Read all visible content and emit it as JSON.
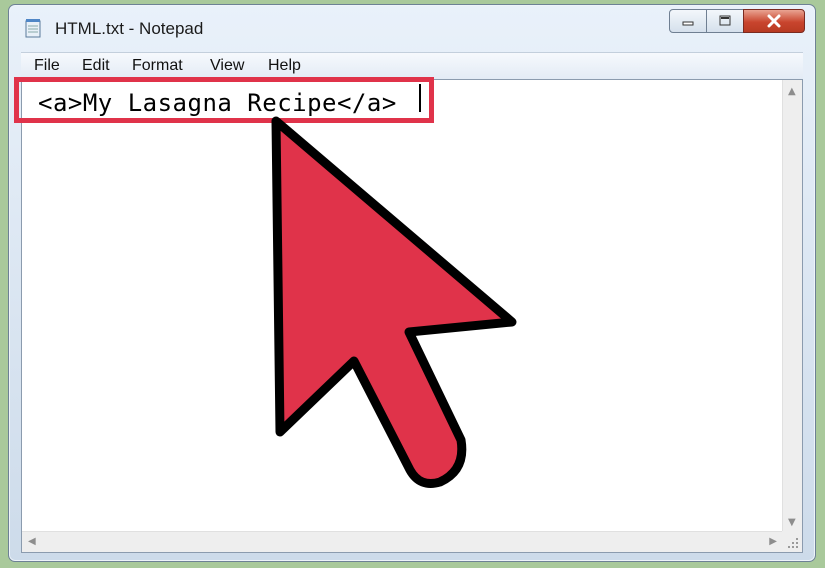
{
  "window": {
    "title": "HTML.txt - Notepad",
    "minimize_icon": "minimize-icon",
    "maximize_icon": "maximize-icon",
    "close_icon": "close-icon"
  },
  "menu": {
    "items": [
      "File",
      "Edit",
      "Format",
      "View",
      "Help"
    ]
  },
  "editor": {
    "content": "<a>My Lasagna Recipe</a>"
  },
  "annotation": {
    "highlight_color": "#e0334a",
    "pointer_color": "#e0334a",
    "pointer_icon": "pointer-arrow-icon"
  }
}
